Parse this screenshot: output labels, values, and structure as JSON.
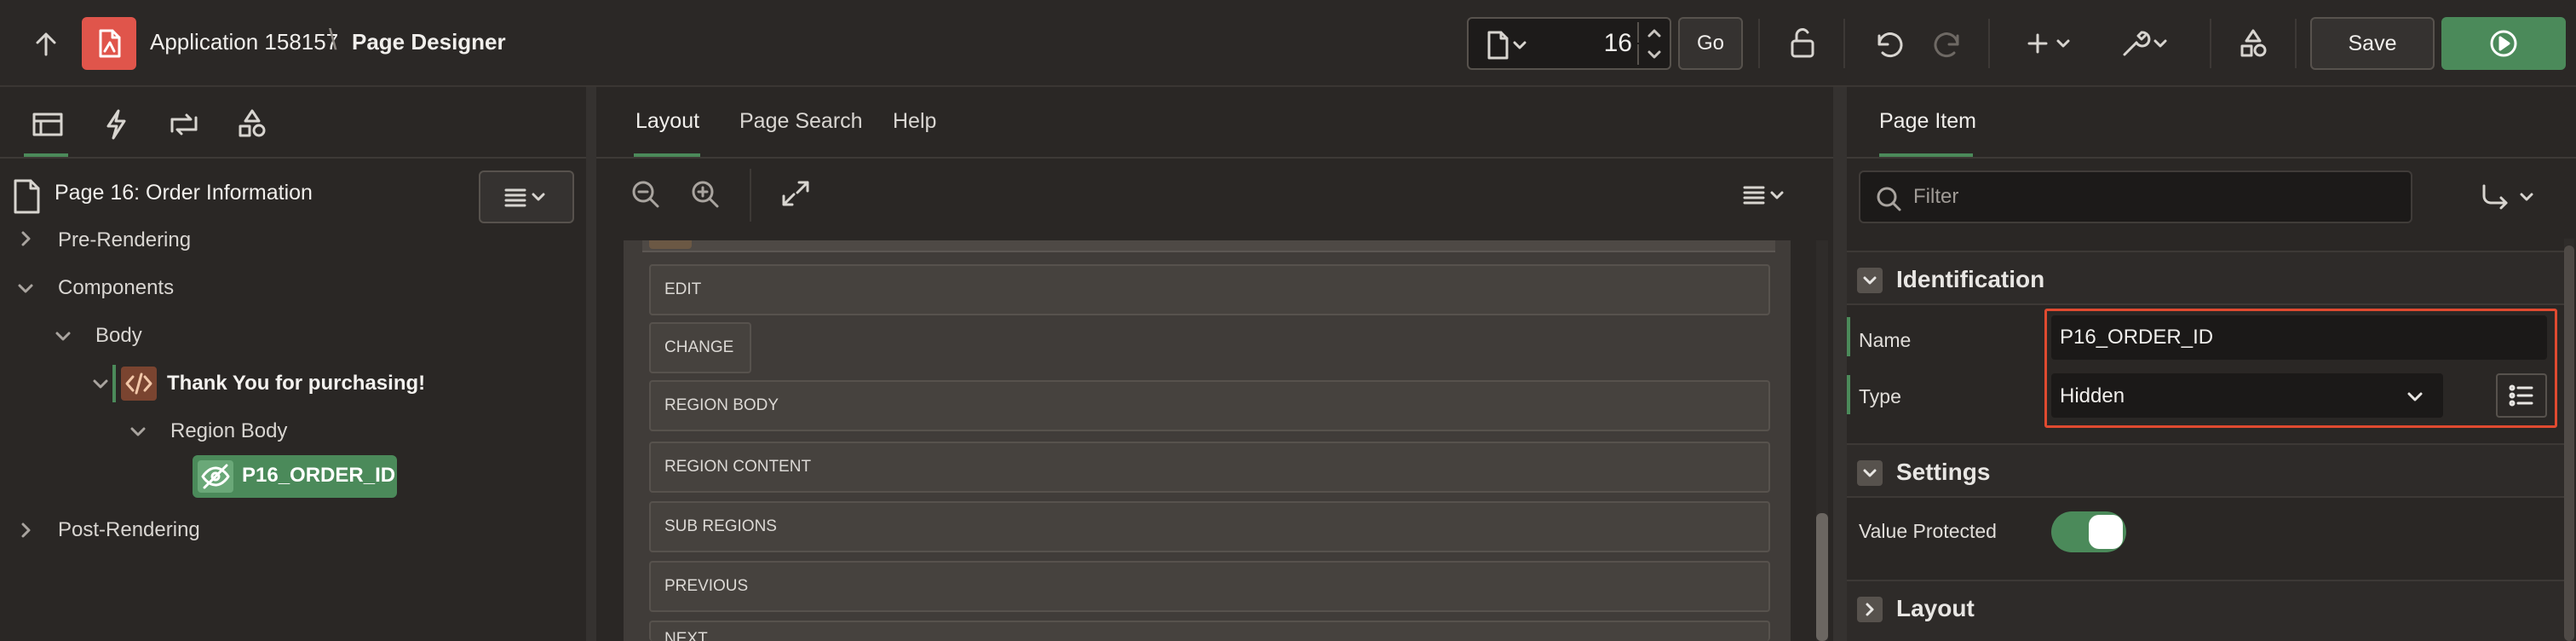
{
  "header": {
    "app_title": "Application 158157",
    "crumb_separator": "\\",
    "page_designer_title": "Page Designer",
    "page_number_value": "16",
    "go_label": "Go",
    "save_label": "Save"
  },
  "left_pane": {
    "tabs": [
      "Rendering",
      "Dynamic Actions",
      "Processing",
      "Shared Components"
    ],
    "tree": {
      "header": "Page 16: Order Information",
      "nodes": {
        "pre_rendering": "Pre-Rendering",
        "components": "Components",
        "body": "Body",
        "thank_you": "Thank You for purchasing!",
        "region_body": "Region Body",
        "item": "P16_ORDER_ID",
        "post_rendering": "Post-Rendering"
      }
    }
  },
  "center_pane": {
    "tabs": {
      "layout": "Layout",
      "page_search": "Page Search",
      "help": "Help"
    },
    "positions": [
      "EDIT",
      "CHANGE",
      "REGION BODY",
      "REGION CONTENT",
      "SUB REGIONS",
      "PREVIOUS",
      "NEXT"
    ]
  },
  "right_pane": {
    "tab": "Page Item",
    "filter_placeholder": "Filter",
    "groups": {
      "identification": "Identification",
      "settings": "Settings",
      "layout": "Layout"
    },
    "properties": {
      "name_label": "Name",
      "name_value": "P16_ORDER_ID",
      "type_label": "Type",
      "type_value": "Hidden",
      "value_protected_label": "Value Protected",
      "value_protected_on": true
    }
  },
  "colors": {
    "accent_green": "#4b8a5a",
    "app_icon_red": "#e0554b",
    "highlight_red": "#e04a30",
    "background": "#2a2725"
  },
  "icons": [
    "up-arrow-icon",
    "app-icon",
    "page-icon",
    "lock-icon",
    "undo-icon",
    "redo-icon",
    "plus-icon",
    "wrench-icon",
    "shared-components-icon",
    "play-icon",
    "zoom-out-icon",
    "zoom-in-icon",
    "expand-icon",
    "menu-icon",
    "search-icon",
    "goto-icon"
  ]
}
